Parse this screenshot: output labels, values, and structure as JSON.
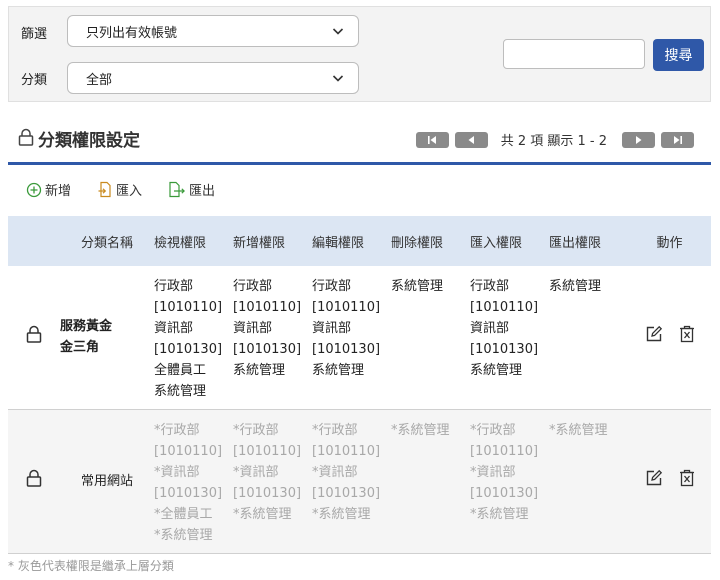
{
  "filter": {
    "filter_label": "篩選",
    "filter_value": "只列出有效帳號",
    "category_label": "分類",
    "category_value": "全部",
    "search_value": "",
    "search_button": "搜尋"
  },
  "header": {
    "title": "分類權限設定",
    "pager_text": "共 2 項 顯示 1 - 2"
  },
  "toolbar": {
    "add": "新增",
    "import": "匯入",
    "export": "匯出"
  },
  "table": {
    "columns": [
      "分類名稱",
      "檢視權限",
      "新增權限",
      "編輯權限",
      "刪除權限",
      "匯入權限",
      "匯出權限",
      "動作"
    ],
    "rows": [
      {
        "name_line1": "服務黃金",
        "name_line2": "金三角",
        "view": [
          "行政部",
          "[1010110]",
          "資訊部",
          "[1010130]",
          "全體員工",
          "系統管理"
        ],
        "add": [
          "行政部",
          "[1010110]",
          "資訊部",
          "[1010130]",
          "系統管理"
        ],
        "edit": [
          "行政部",
          "[1010110]",
          "資訊部",
          "[1010130]",
          "系統管理"
        ],
        "delete": [
          "系統管理"
        ],
        "import": [
          "行政部",
          "[1010110]",
          "資訊部",
          "[1010130]",
          "系統管理"
        ],
        "export": [
          "系統管理"
        ]
      },
      {
        "name_line1": "常用網站",
        "view": [
          "*行政部",
          "[1010110]",
          "*資訊部",
          "[1010130]",
          "*全體員工",
          "*系統管理"
        ],
        "add": [
          "*行政部",
          "[1010110]",
          "*資訊部",
          "[1010130]",
          "*系統管理"
        ],
        "edit": [
          "*行政部",
          "[1010110]",
          "*資訊部",
          "[1010130]",
          "*系統管理"
        ],
        "delete": [
          "*系統管理"
        ],
        "import": [
          "*行政部",
          "[1010110]",
          "*資訊部",
          "[1010130]",
          "*系統管理"
        ],
        "export": [
          "*系統管理"
        ]
      }
    ]
  },
  "footnote": "* 灰色代表權限是繼承上層分類",
  "colors": {
    "accent": "#2f58a8",
    "header_bg": "#dce6f3",
    "inherited_text": "#a8a8a8",
    "add_icon": "#3a9a3a",
    "doc_icon": "#c98a1e"
  }
}
